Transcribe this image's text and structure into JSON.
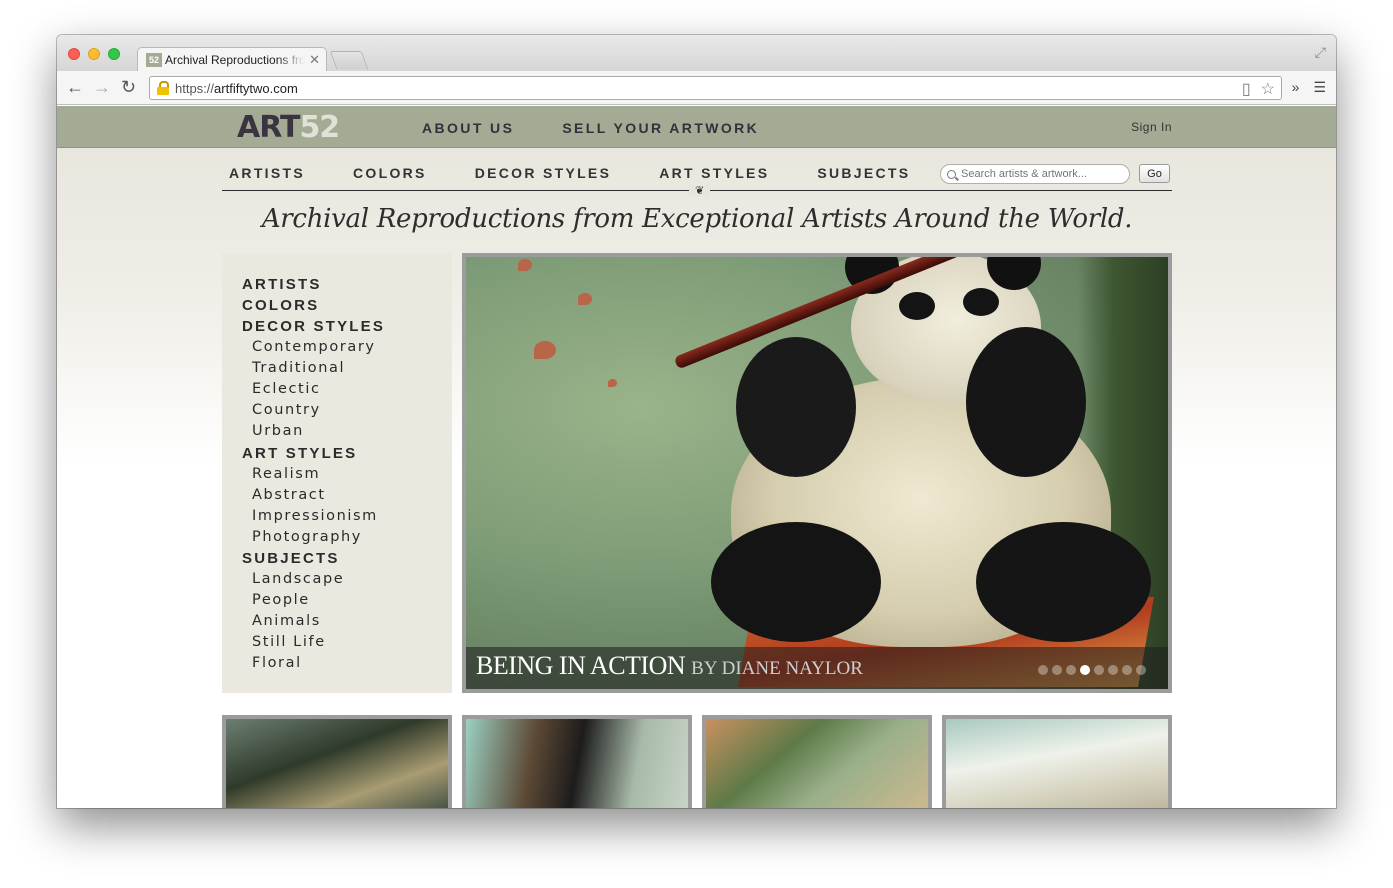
{
  "browser": {
    "tab_title": "Archival Reproductions from Exceptional Artists Around the World",
    "favicon_text": "52",
    "url_protocol": "https://",
    "url_host": "artfiftytwo.com",
    "extensions_chevron": "»"
  },
  "site": {
    "logo_part1": "ART",
    "logo_part2": "52",
    "top_nav": [
      "ABOUT US",
      "SELL YOUR ARTWORK"
    ],
    "sign_in": "Sign In",
    "category_nav": [
      "ARTISTS",
      "COLORS",
      "DECOR STYLES",
      "ART STYLES",
      "SUBJECTS"
    ],
    "search_placeholder": "Search artists & artwork...",
    "search_button": "Go",
    "tagline": "Archival Reproductions from Exceptional Artists Around the World.",
    "colors": {
      "header": "#a3ab94",
      "logo_dark": "#3a3340",
      "logo_light": "#dfe2d6"
    }
  },
  "sidebar": {
    "artists": "ARTISTS",
    "colors": "COLORS",
    "decor_styles": {
      "label": "DECOR STYLES",
      "items": [
        "Contemporary",
        "Traditional",
        "Eclectic",
        "Country",
        "Urban"
      ]
    },
    "art_styles": {
      "label": "ART STYLES",
      "items": [
        "Realism",
        "Abstract",
        "Impressionism",
        "Photography"
      ]
    },
    "subjects": {
      "label": "SUBJECTS",
      "items": [
        "Landscape",
        "People",
        "Animals",
        "Still Life",
        "Floral"
      ]
    }
  },
  "hero": {
    "title": "BEING IN ACTION",
    "byline": "BY DIANE NAYLOR",
    "slide_count": 8,
    "active_slide": 4
  }
}
